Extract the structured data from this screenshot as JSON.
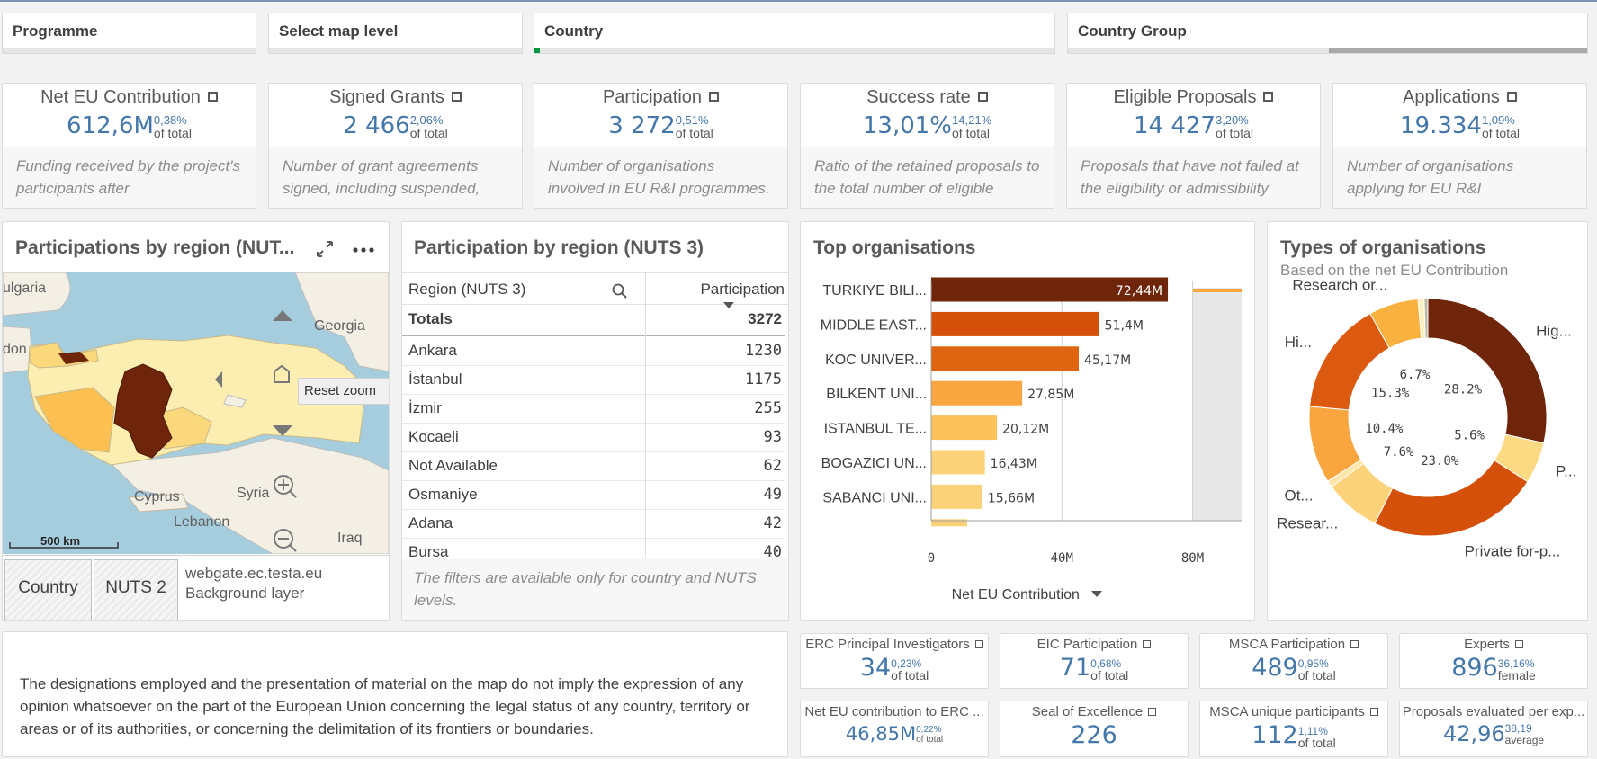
{
  "filters": [
    "Programme",
    "Select map level",
    "Country",
    "Country Group"
  ],
  "kpis": [
    {
      "title": "Net EU Contribution",
      "value": "612,6M",
      "pct": "0,38%",
      "sub": "of total",
      "desc": "Funding received by the project's participants after"
    },
    {
      "title": "Signed Grants",
      "value": "2 466",
      "pct": "2,06%",
      "sub": "of total",
      "desc": "Number of grant agreements signed, including suspended,"
    },
    {
      "title": "Participation",
      "value": "3 272",
      "pct": "0,51%",
      "sub": "of total",
      "desc": "Number of organisations involved in EU R&I programmes."
    },
    {
      "title": "Success rate",
      "value": "13,01%",
      "pct": "14,21%",
      "sub": "of total",
      "desc": "Ratio of the retained proposals to the total number of eligible"
    },
    {
      "title": "Eligible Proposals",
      "value": "14 427",
      "pct": "3,20%",
      "sub": "of total",
      "desc": "Proposals that have not failed at the eligibility or admissibility"
    },
    {
      "title": "Applications",
      "value": "19.334",
      "pct": "1,09%",
      "sub": "of total",
      "desc": "Number of organisations applying for EU R&I"
    }
  ],
  "map": {
    "title": "Participations by region (NUT...",
    "labels": {
      "bulgaria": "ulgaria",
      "georgia": "Georgia",
      "don": "don",
      "cyprus": "Cyprus",
      "syria": "Syria",
      "lebanon": "Lebanon",
      "iraq": "Iraq"
    },
    "reset_zoom": "Reset zoom",
    "scale": "500 km",
    "footer": {
      "country": "Country",
      "nuts2": "NUTS 2",
      "source": "webgate.ec.testa.eu",
      "layer": "Background layer"
    },
    "colors": {
      "water": "#a6cddd",
      "land": "#f3efe4",
      "light": "#fbeeb0",
      "mid": "#fbbf52",
      "dark": "#6e2509"
    }
  },
  "table": {
    "title": "Participation by region (NUTS 3)",
    "col1": "Region (NUTS 3)",
    "col2": "Participation",
    "totals_label": "Totals",
    "totals_value": "3272",
    "rows": [
      {
        "region": "Ankara",
        "value": "1230"
      },
      {
        "region": "İstanbul",
        "value": "1175"
      },
      {
        "region": "İzmir",
        "value": "255"
      },
      {
        "region": "Kocaeli",
        "value": "93"
      },
      {
        "region": "Not Available",
        "value": "62"
      },
      {
        "region": "Osmaniye",
        "value": "49"
      },
      {
        "region": "Adana",
        "value": "42"
      },
      {
        "region": "Bursa",
        "value": "40"
      }
    ],
    "note": "The filters are available only for country and NUTS levels."
  },
  "top_orgs": {
    "title": "Top organisations",
    "measure_label": "Net EU Contribution"
  },
  "types": {
    "title": "Types of organisations",
    "subtitle": "Based on the net EU Contribution"
  },
  "chart_data": [
    {
      "type": "bar",
      "orientation": "horizontal",
      "title": "Top organisations",
      "xlabel": "Net EU Contribution",
      "categories": [
        "TURKIYE BILI...",
        "MIDDLE EAST...",
        "KOC UNIVER...",
        "BILKENT UNI...",
        "ISTANBUL TE...",
        "BOGAZICI UN...",
        "SABANCI UNI..."
      ],
      "values": [
        72.44,
        51.4,
        45.17,
        27.85,
        20.12,
        16.43,
        15.66
      ],
      "value_labels": [
        "72,44M",
        "51,4M",
        "45,17M",
        "27,85M",
        "20,12M",
        "16,43M",
        "15,66M"
      ],
      "colors": [
        "#6e2509",
        "#d4500b",
        "#e06510",
        "#f9a540",
        "#fbc15a",
        "#fcd27a",
        "#fcd27a"
      ],
      "xlim": [
        0,
        95
      ],
      "xticks": [
        {
          "value": 0,
          "label": "0"
        },
        {
          "value": 40,
          "label": "40M"
        },
        {
          "value": 80,
          "label": "80M"
        }
      ],
      "grid": true
    },
    {
      "type": "pie",
      "donut": true,
      "title": "Types of organisations",
      "subtitle": "Based on the net EU Contribution",
      "slices": [
        {
          "label": "Hig...",
          "value": 28.2,
          "pct_label": "28.2%",
          "color": "#6e2509"
        },
        {
          "label": "P...",
          "value": 5.6,
          "pct_label": "5.6%",
          "color": "#fcd983"
        },
        {
          "label": "Private for-p...",
          "value": 23.0,
          "pct_label": "23.0%",
          "color": "#d4500b"
        },
        {
          "label": "Resear...",
          "value": 7.6,
          "pct_label": "7.6%",
          "color": "#fcd27a"
        },
        {
          "label": "Ot...",
          "value": 0.9,
          "pct_label": "",
          "color": "#fde6a8"
        },
        {
          "label": "",
          "value": 10.4,
          "pct_label": "10.4%",
          "color": "#f9a540"
        },
        {
          "label": "Hi...",
          "value": 15.3,
          "pct_label": "15.3%",
          "color": "#dc5a10"
        },
        {
          "label": "Research or...",
          "value": 6.7,
          "pct_label": "6.7%",
          "color": "#f9b240"
        },
        {
          "label": "",
          "value": 0.8,
          "pct_label": "",
          "color": "#fdf0c0"
        },
        {
          "label": "",
          "value": 0.5,
          "pct_label": "",
          "color": "#bdb7a8"
        }
      ]
    }
  ],
  "disclaimer": "The designations employed and the presentation of material on the map do not imply the expression of any opinion whatsoever on the part of the European Union concerning the legal status of any country, territory or areas or of its authorities, or concerning the delimitation of its frontiers or boundaries.",
  "small_kpis": [
    {
      "title": "ERC Principal Investigators",
      "value": "34",
      "pct": "0,23%",
      "sub": "of total"
    },
    {
      "title": "EIC Participation",
      "value": "71",
      "pct": "0,68%",
      "sub": "of total"
    },
    {
      "title": "MSCA Participation",
      "value": "489",
      "pct": "0,95%",
      "sub": "of total"
    },
    {
      "title": "Experts",
      "value": "896",
      "pct": "36,16%",
      "sub": "female"
    },
    {
      "title": "Net EU contribution to ERC ...",
      "value": "46,85M",
      "pct": "0,22%",
      "sub": "of total"
    },
    {
      "title": "Seal of Excellence",
      "value": "226",
      "pct": "",
      "sub": ""
    },
    {
      "title": "MSCA unique participants",
      "value": "112",
      "pct": "1,11%",
      "sub": "of total"
    },
    {
      "title": "Proposals evaluated per exp...",
      "value": "42,96",
      "pct": "38,19",
      "sub": "average"
    }
  ]
}
